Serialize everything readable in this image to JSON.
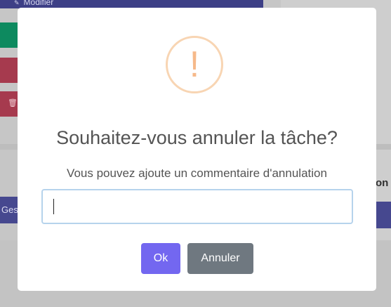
{
  "background": {
    "top_label": "Modifier",
    "side_label": "Ges",
    "right_label": "on"
  },
  "dialog": {
    "icon": "warning-icon",
    "icon_glyph": "!",
    "icon_color": "#f6b98a",
    "title": "Souhaitez-vous annuler la tâche?",
    "subtitle": "Vous pouvez ajoute un commentaire d'annulation",
    "comment_value": "",
    "confirm_label": "Ok",
    "cancel_label": "Annuler",
    "confirm_color": "#7367f0",
    "cancel_color": "#6f7880"
  }
}
